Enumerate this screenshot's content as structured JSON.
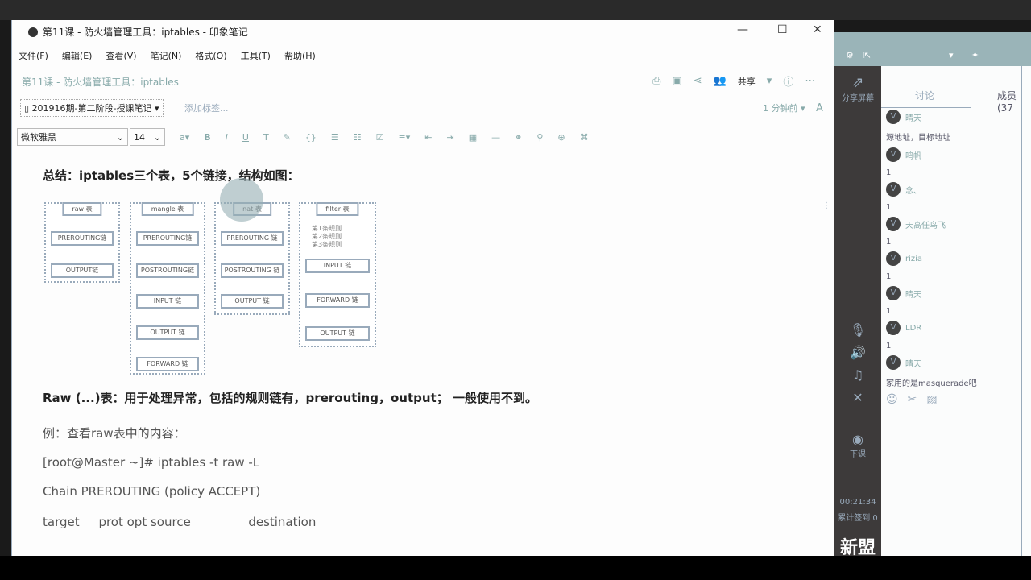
{
  "window": {
    "title": "第11课 - 防火墙管理工具：iptables - 印象笔记",
    "minimize": "—",
    "maximize": "☐",
    "close": "✕"
  },
  "menu": [
    "文件(F)",
    "编辑(E)",
    "查看(V)",
    "笔记(N)",
    "格式(O)",
    "工具(T)",
    "帮助(H)"
  ],
  "note": {
    "title": "第11课 - 防火墙管理工具：iptables",
    "notebook": "201916期-第二阶段-授课笔记",
    "add_tag": "添加标签...",
    "updated": "1 分钟前",
    "share": "共享"
  },
  "toolbar": {
    "font": "微软雅黑",
    "size": "14",
    "icons": [
      "font-color-icon",
      "bold-icon",
      "italic-icon",
      "underline-icon",
      "strikethrough-icon",
      "highlight-icon",
      "code-icon",
      "bullet-list-icon",
      "numbered-list-icon",
      "checkbox-icon",
      "align-icon",
      "outdent-icon",
      "indent-icon",
      "table-icon",
      "divider-icon",
      "link-icon",
      "attachment-icon",
      "more-icon",
      "format-icon"
    ]
  },
  "content": {
    "summary": "总结：iptables三个表，5个链接，结构如图：",
    "raw_line": "Raw (...)表：用于处理异常，包括的规则链有，prerouting，output； 一般使用不到。",
    "example": "例：查看raw表中的内容：",
    "cmd": "[root@Master ~]# iptables -t raw -L",
    "chain": "Chain PREROUTING (policy ACCEPT)",
    "header": "target     prot opt source               destination"
  },
  "diagram": {
    "tables": [
      {
        "name": "raw 表",
        "chains": [
          "PREROUTING链",
          "OUTPUT链"
        ]
      },
      {
        "name": "mangle 表",
        "chains": [
          "PREROUTING链",
          "POSTROUTING链",
          "INPUT 链",
          "OUTPUT 链",
          "FORWARD 链"
        ]
      },
      {
        "name": "nat 表",
        "chains": [
          "PREROUTING 链",
          "POSTROUTING 链",
          "OUTPUT 链"
        ]
      },
      {
        "name": "filter 表",
        "rules": [
          "第1条规则",
          "第2条规则",
          "第3条规则"
        ],
        "chains": [
          "INPUT 链",
          "FORWARD 链",
          "OUTPUT 链"
        ]
      }
    ]
  },
  "chat": {
    "tabs": [
      "讨论",
      "成员(37"
    ],
    "share_screen": "分享屏幕",
    "end_class": "下课",
    "timer": "00:21:34",
    "stats": "累计签到 0",
    "messages": [
      {
        "user": "晴天",
        "text": "源地址，目标地址"
      },
      {
        "user": "鸣帆",
        "text": "1"
      },
      {
        "user": "念、",
        "text": "1"
      },
      {
        "user": "天高任鸟飞",
        "text": "1"
      },
      {
        "user": "rizia",
        "text": "1"
      },
      {
        "user": "晴天",
        "text": "1"
      },
      {
        "user": "LDR",
        "text": "1"
      },
      {
        "user": "晴天",
        "text": "家用的是masquerade吧"
      }
    ],
    "avatar_letter": "V",
    "watermark": "新盟"
  }
}
